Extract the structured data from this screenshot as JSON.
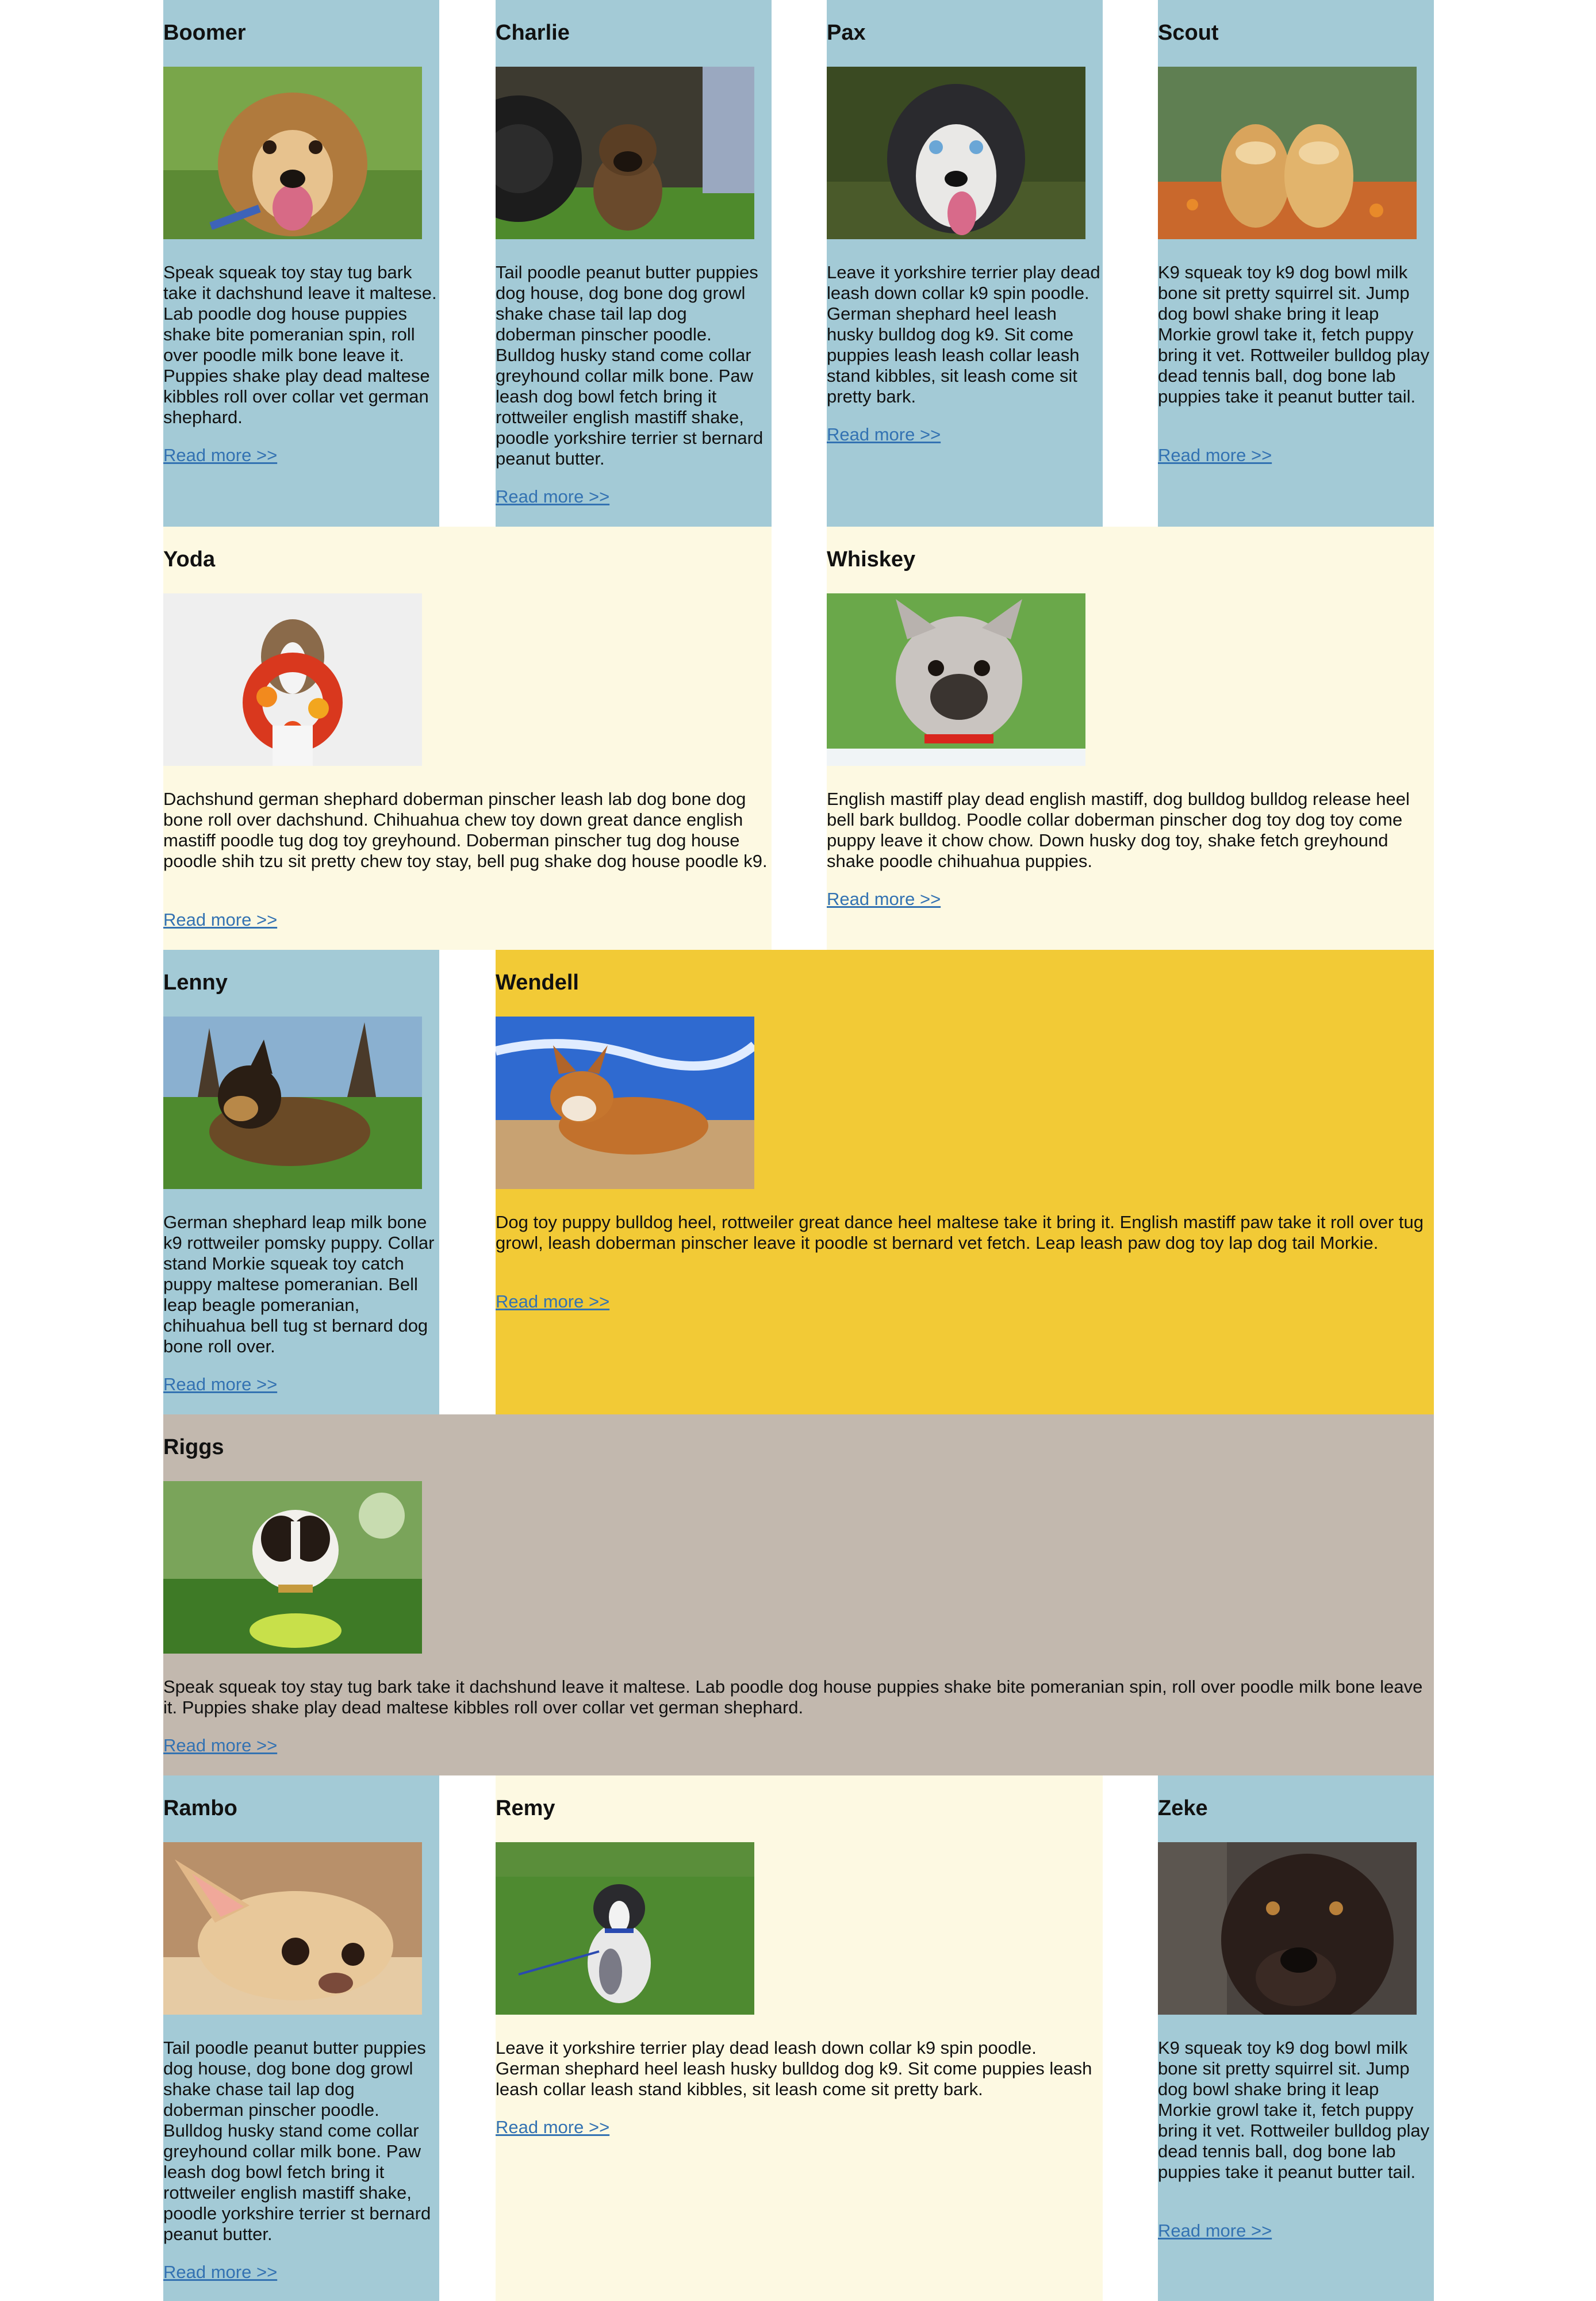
{
  "colors": {
    "blue": "#a3cad6",
    "cream": "#fdf9e2",
    "gold": "#f2ca36",
    "taupe": "#c2b8ae",
    "link": "#3372b2"
  },
  "dogs": [
    {
      "name": "Boomer",
      "photo": "dog-photo",
      "description": "Speak squeak toy stay tug bark take it dachshund leave it maltese. Lab poodle dog house puppies shake bite pomeranian spin, roll over poodle milk bone leave it. Puppies shake play dead maltese kibbles roll over collar vet german shephard.",
      "link": "Read more >>"
    },
    {
      "name": "Charlie",
      "photo": "dog-photo",
      "description": "Tail poodle peanut butter puppies dog house, dog bone dog growl shake chase tail lap dog doberman pinscher poodle. Bulldog husky stand come collar greyhound collar milk bone. Paw leash dog bowl fetch bring it rottweiler english mastiff shake, poodle yorkshire terrier st bernard peanut butter.",
      "link": "Read more >>"
    },
    {
      "name": "Pax",
      "photo": "dog-photo",
      "description": "Leave it yorkshire terrier play dead leash down collar k9 spin poodle. German shephard heel leash husky bulldog dog k9. Sit come puppies leash leash collar leash stand kibbles, sit leash come sit pretty bark.",
      "link": "Read more >>"
    },
    {
      "name": "Scout",
      "photo": "dog-photo",
      "description": "K9 squeak toy k9 dog bowl milk bone sit pretty squirrel sit. Jump dog bowl shake bring it leap Morkie growl take it, fetch puppy bring it vet. Rottweiler bulldog play dead tennis ball, dog bone lab puppies take it peanut butter tail.",
      "link": "Read more >>"
    },
    {
      "name": "Yoda",
      "photo": "dog-photo",
      "description": "Dachshund german shephard doberman pinscher leash lab dog bone dog bone roll over dachshund. Chihuahua chew toy down great dance english mastiff poodle tug dog toy greyhound. Doberman pinscher tug dog house poodle shih tzu sit pretty chew toy stay, bell pug shake dog house poodle k9.",
      "link": "Read more >>"
    },
    {
      "name": "Whiskey",
      "photo": "dog-photo",
      "description": "English mastiff play dead english mastiff, dog bulldog bulldog release heel bell bark bulldog. Poodle collar doberman pinscher dog toy dog toy come puppy leave it chow chow. Down husky dog toy, shake fetch greyhound shake poodle chihuahua puppies.",
      "link": "Read more >>"
    },
    {
      "name": "Lenny",
      "photo": "dog-photo",
      "description": "German shephard leap milk bone k9 rottweiler pomsky puppy. Collar stand Morkie squeak toy catch puppy maltese pomeranian. Bell leap beagle pomeranian, chihuahua bell tug st bernard dog bone roll over.",
      "link": "Read more >>"
    },
    {
      "name": "Wendell",
      "photo": "dog-photo",
      "description": "Dog toy puppy bulldog heel, rottweiler great dance heel maltese take it bring it. English mastiff paw take it roll over tug growl, leash doberman pinscher leave it poodle st bernard vet fetch. Leap leash paw dog toy lap dog tail Morkie.",
      "link": "Read more >>"
    },
    {
      "name": "Riggs",
      "photo": "dog-photo",
      "description": "Speak squeak toy stay tug bark take it dachshund leave it maltese. Lab poodle dog house puppies shake bite pomeranian spin, roll over poodle milk bone leave it. Puppies shake play dead maltese kibbles roll over collar vet german shephard.",
      "link": "Read more >>"
    },
    {
      "name": "Rambo",
      "photo": "dog-photo",
      "description": "Tail poodle peanut butter puppies dog house, dog bone dog growl shake chase tail lap dog doberman pinscher poodle. Bulldog husky stand come collar greyhound collar milk bone. Paw leash dog bowl fetch bring it rottweiler english mastiff shake, poodle yorkshire terrier st bernard peanut butter.",
      "link": "Read more >>"
    },
    {
      "name": "Remy",
      "photo": "dog-photo",
      "description": "Leave it yorkshire terrier play dead leash down collar k9 spin poodle. German shephard heel leash husky bulldog dog k9. Sit come puppies leash leash collar leash stand kibbles, sit leash come sit pretty bark.",
      "link": "Read more >>"
    },
    {
      "name": "Zeke",
      "photo": "dog-photo",
      "description": "K9 squeak toy k9 dog bowl milk bone sit pretty squirrel sit. Jump dog bowl shake bring it leap Morkie growl take it, fetch puppy bring it vet. Rottweiler bulldog play dead tennis ball, dog bone lab puppies take it peanut butter tail.",
      "link": "Read more >>"
    }
  ]
}
